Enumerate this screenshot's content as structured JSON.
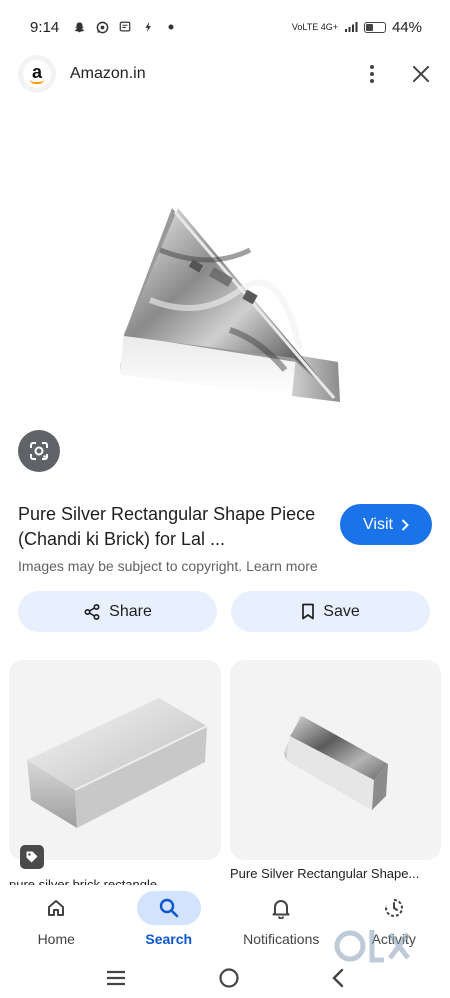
{
  "status_bar": {
    "time": "9:14",
    "network": "VoLTE 4G+",
    "battery_level": 0.44,
    "battery_pct": "44%"
  },
  "header": {
    "site_name": "Amazon.in",
    "logo_letter": "a"
  },
  "result": {
    "title": "Pure Silver Rectangular Shape Piece (Chandi ki Brick) for Lal ...",
    "copyright_text": "Images may be subject to copyright.",
    "learn_more": "Learn more",
    "visit_label": "Visit"
  },
  "actions": {
    "share_label": "Share",
    "save_label": "Save"
  },
  "related": [
    {
      "label": "pure silver brick rectangle"
    },
    {
      "label": "Pure Silver Rectangular Shape..."
    }
  ],
  "bottom_nav": [
    {
      "label": "Home",
      "icon": "home-icon",
      "active": false
    },
    {
      "label": "Search",
      "icon": "search-icon",
      "active": true
    },
    {
      "label": "Notifications",
      "icon": "bell-icon",
      "active": false
    },
    {
      "label": "Activity",
      "icon": "activity-icon",
      "active": false
    }
  ],
  "colors": {
    "accent": "#1a73e8",
    "chip_bg": "#e8f0fe",
    "nav_active_bg": "#d3e3fd"
  }
}
